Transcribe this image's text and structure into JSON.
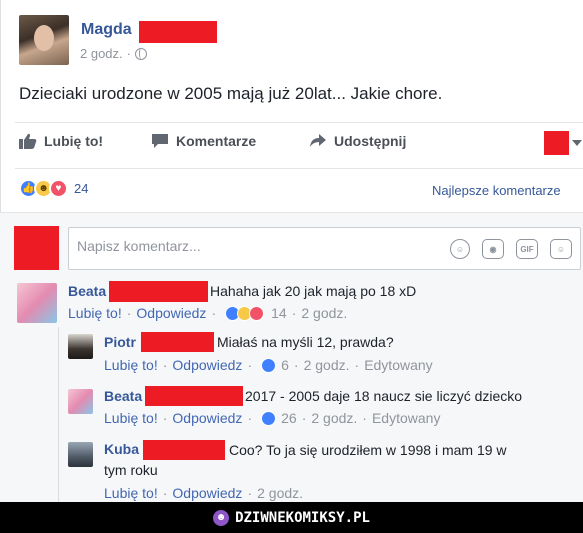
{
  "post": {
    "author": "Magda",
    "time": "2 godz.",
    "separator": "·",
    "text": "Dzieciaki urodzone w 2005 mają już 20lat... Jakie chore.",
    "actions": {
      "like": "Lubię to!",
      "comment": "Komentarze",
      "share": "Udostępnij"
    },
    "reaction_count": "24",
    "best_comments": "Najlepsze komentarze"
  },
  "comment_input": {
    "placeholder": "Napisz komentarz..."
  },
  "comments": [
    {
      "name": "Beata",
      "text": "Hahaha jak 20 jak mają po 18 xD",
      "like": "Lubię to!",
      "reply": "Odpowiedz",
      "reactions": "14",
      "time": "2 godz."
    },
    {
      "name": "Piotr",
      "text": "Miałaś na myśli 12, prawda?",
      "like": "Lubię to!",
      "reply": "Odpowiedz",
      "reactions": "6",
      "time": "2 godz.",
      "edited": "Edytowany"
    },
    {
      "name": "Beata",
      "text": "2017 - 2005 daje 18 naucz sie liczyć dziecko",
      "like": "Lubię to!",
      "reply": "Odpowiedz",
      "reactions": "26",
      "time": "2 godz.",
      "edited": "Edytowany"
    },
    {
      "name": "Kuba",
      "text_line1": "Coo? To ja się urodziłem w 1998 i mam 19 w",
      "text_line2": "tym roku",
      "like": "Lubię to!",
      "reply": "Odpowiedz",
      "time": "2 godz."
    }
  ],
  "footer": {
    "site": "DZIWNEKOMIKSY.PL"
  },
  "colors": {
    "link": "#365899",
    "redaction": "#ed1c24",
    "footer_bg": "#000000",
    "like_blue": "#4080ff"
  }
}
